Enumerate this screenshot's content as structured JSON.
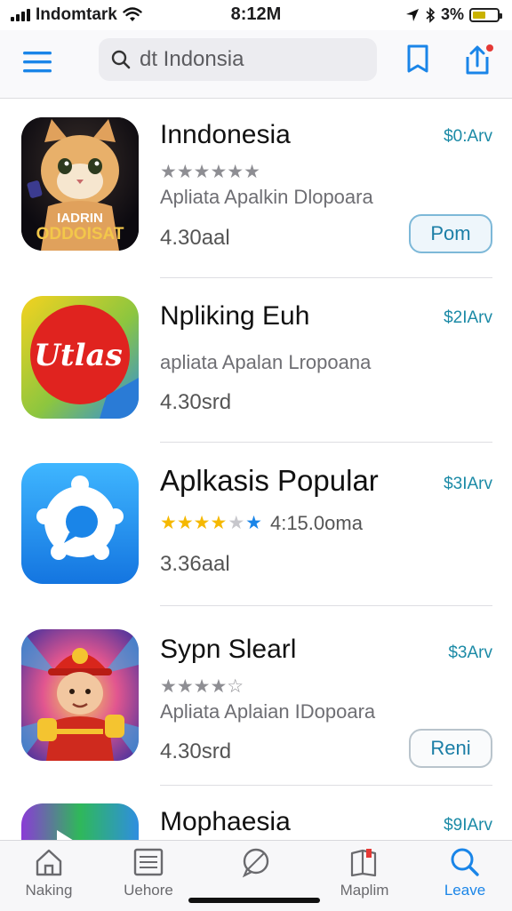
{
  "status_bar": {
    "carrier": "Indomtark",
    "time": "8:12M",
    "battery": "3%",
    "battery_color": "#c9b200"
  },
  "nav": {
    "search_text": "dt Indonsia",
    "menu_icon": "hamburger-icon",
    "bookmark_icon": "bookmark-icon",
    "share_icon": "share-icon"
  },
  "apps": [
    {
      "name": "Inndonesia",
      "price": "$0:Arv",
      "rating": 5,
      "stars": "★★★★★★",
      "subtitle": "Apliata Apalkin Dlopoara",
      "meta": "4.30aal",
      "button": "Pom",
      "icon": "cat-game-icon",
      "icon_text": [
        "IADRIN",
        "ODDOISAT"
      ]
    },
    {
      "name": "Npliking Euh",
      "price": "$2IArv",
      "subtitle": "apliata Apalan Lropoana",
      "meta": "4.30srd",
      "icon": "red-logo-icon",
      "icon_text": "Utlas"
    },
    {
      "name": "Aplkasis Popular",
      "price": "$3IArv",
      "stars": "★★★★★★",
      "rating_text": "4:15.0oma",
      "meta": "3.36aal",
      "icon": "chat-bubble-icon"
    },
    {
      "name": "Sypn Slearl",
      "price": "$3Arv",
      "stars": "★★★★☆",
      "subtitle": "Apliata Aplaian IDopoara",
      "meta": "4.30srd",
      "button": "Reni",
      "icon": "firefighter-icon"
    },
    {
      "name": "Mophaesia",
      "price": "$9IArv",
      "icon": "play-icon"
    }
  ],
  "tabs": [
    {
      "label": "Naking",
      "icon": "home-icon"
    },
    {
      "label": "Uehore",
      "icon": "list-icon"
    },
    {
      "label": "",
      "icon": "chat-icon"
    },
    {
      "label": "Maplim",
      "icon": "book-icon"
    },
    {
      "label": "Leave",
      "icon": "search-icon",
      "active": true
    }
  ],
  "colors": {
    "accent": "#1a85e8",
    "price": "#1b8aa6",
    "star_gold": "#f5b800"
  }
}
